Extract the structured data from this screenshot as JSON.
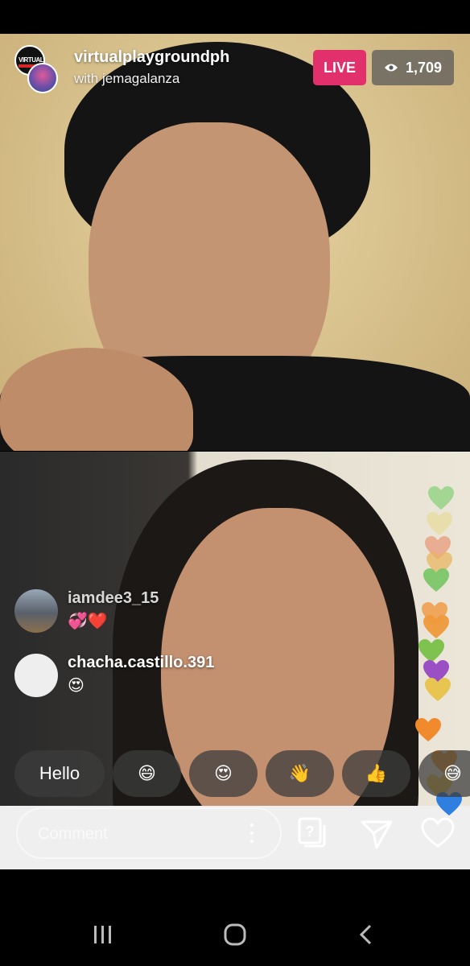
{
  "header": {
    "host_name": "virtualplaygroundph",
    "with_line": "with jemagalanza",
    "host_avatar_text": "VIRTUAL",
    "live_label": "LIVE",
    "viewer_count": "1,709"
  },
  "comments": [
    {
      "user": "iamdee3_15",
      "text": "💞❤️"
    },
    {
      "user": "chacha.castillo.391",
      "text": "😍"
    }
  ],
  "quick_reactions": [
    "Hello",
    "😄",
    "😍",
    "👋",
    "👍",
    "😅"
  ],
  "comment_bar": {
    "placeholder": "Comment"
  },
  "colors": {
    "live_badge": "#e1306c",
    "hearts": [
      "#8bd17c",
      "#e8d98a",
      "#e9a080",
      "#e9b45a",
      "#7dc76a",
      "#f0a050",
      "#f09a3c",
      "#7fc24f",
      "#9b4fc4",
      "#e8c450",
      "#f08a2c",
      "#f29b30",
      "#f0c74a",
      "#2f7fe0"
    ]
  },
  "icons": [
    "eye-icon",
    "question-stack-icon",
    "send-icon",
    "heart-outline-icon",
    "more-dots-icon",
    "recents-icon",
    "home-icon",
    "back-icon"
  ]
}
